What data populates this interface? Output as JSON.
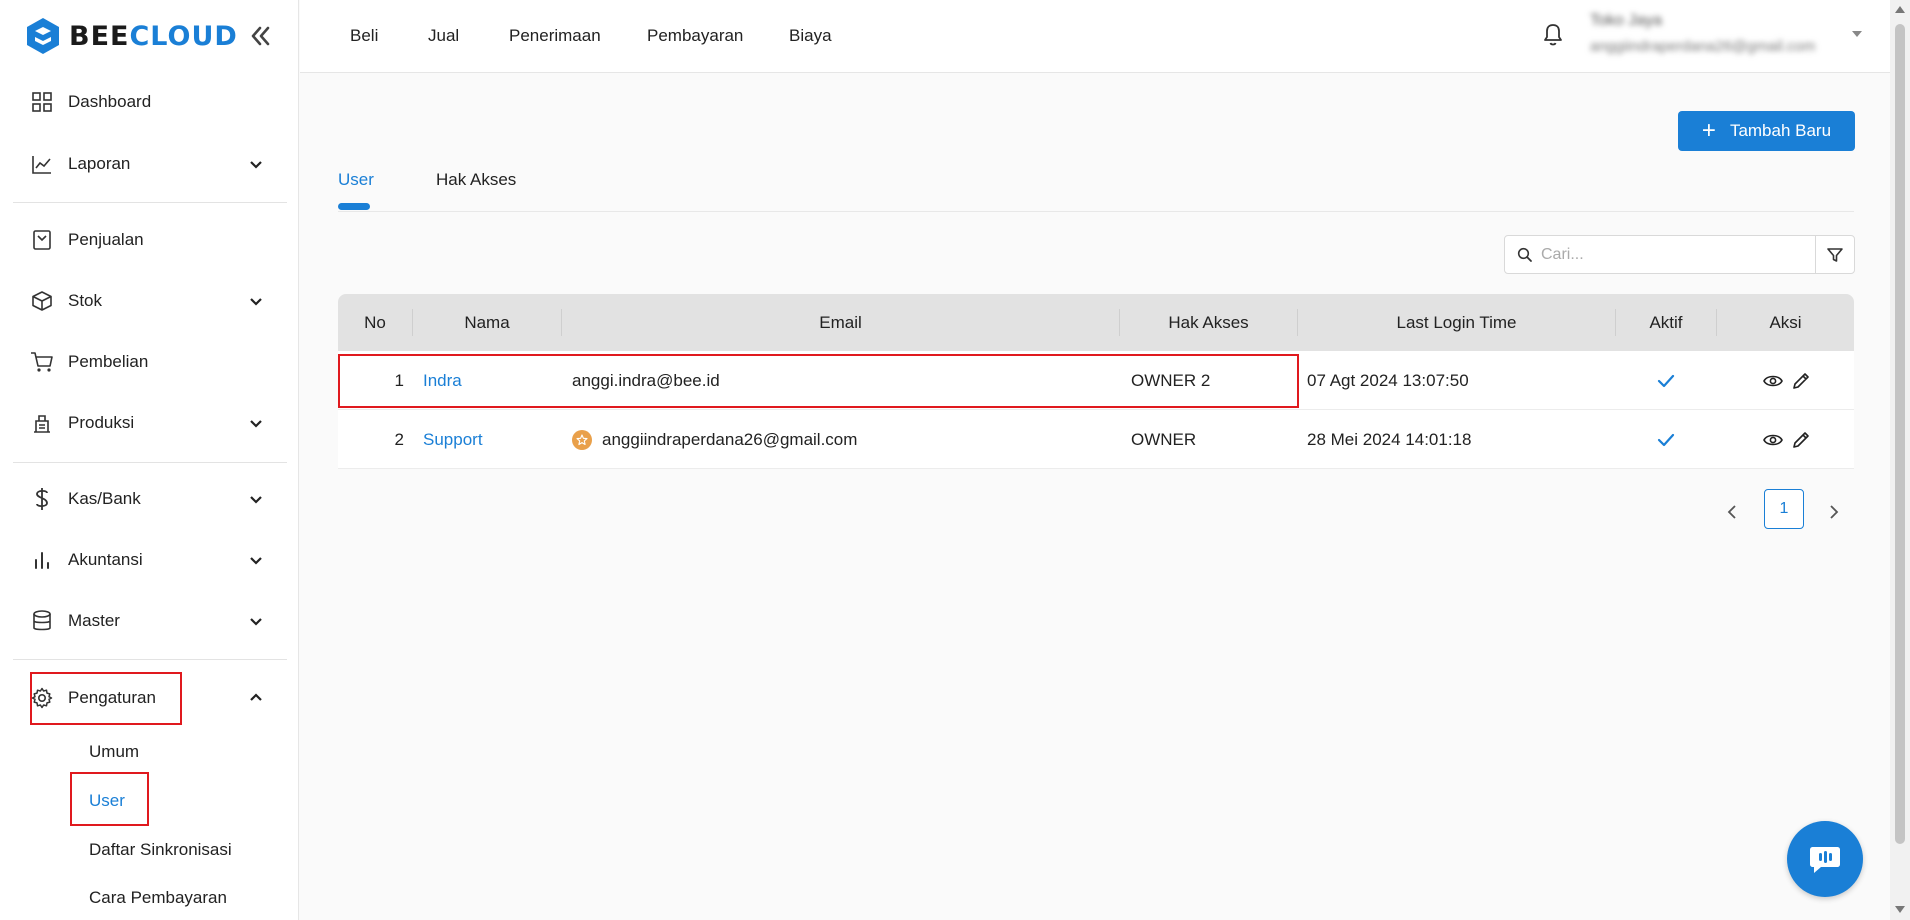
{
  "brand": {
    "part1": "BEE",
    "part2": "CLOUD",
    "accent": "#1a7fd6"
  },
  "sidebar": {
    "items": [
      {
        "label": "Dashboard",
        "icon": "dashboard-icon"
      },
      {
        "label": "Laporan",
        "icon": "chart-line-icon"
      },
      {
        "label": "Penjualan",
        "icon": "receipt-icon"
      },
      {
        "label": "Stok",
        "icon": "box-icon"
      },
      {
        "label": "Pembelian",
        "icon": "cart-icon"
      },
      {
        "label": "Produksi",
        "icon": "factory-icon"
      },
      {
        "label": "Kas/Bank",
        "icon": "dollar-icon"
      },
      {
        "label": "Akuntansi",
        "icon": "bar-chart-icon"
      },
      {
        "label": "Master",
        "icon": "database-icon"
      },
      {
        "label": "Pengaturan",
        "icon": "gear-icon"
      }
    ],
    "sub_items": [
      {
        "label": "Umum"
      },
      {
        "label": "User"
      },
      {
        "label": "Daftar Sinkronisasi"
      },
      {
        "label": "Cara Pembayaran"
      }
    ]
  },
  "topnav": {
    "items": [
      "Beli",
      "Jual",
      "Penerimaan",
      "Pembayaran",
      "Biaya"
    ]
  },
  "user": {
    "name": "Toko Jaya",
    "email": "anggiindraperdana26@gmail.com"
  },
  "main": {
    "add_button": "Tambah Baru",
    "tabs": [
      {
        "label": "User"
      },
      {
        "label": "Hak Akses"
      }
    ],
    "search": {
      "placeholder": "Cari..."
    },
    "table": {
      "headers": [
        "No",
        "Nama",
        "Email",
        "Hak Akses",
        "Last Login Time",
        "Aktif",
        "Aksi"
      ],
      "rows": [
        {
          "no": "1",
          "nama": "Indra",
          "email": "anggi.indra@bee.id",
          "hak_akses": "OWNER 2",
          "last_login": "07 Agt 2024 13:07:50",
          "aktif": true
        },
        {
          "no": "2",
          "nama": "Support",
          "email": "anggiindraperdana26@gmail.com",
          "hak_akses": "OWNER",
          "last_login": "28 Mei 2024 14:01:18",
          "aktif": true
        }
      ]
    },
    "pagination": {
      "current": "1"
    }
  },
  "colors": {
    "primary": "#1a7fd6",
    "highlight": "#e0191e",
    "header_bg": "#e2e2e2"
  }
}
